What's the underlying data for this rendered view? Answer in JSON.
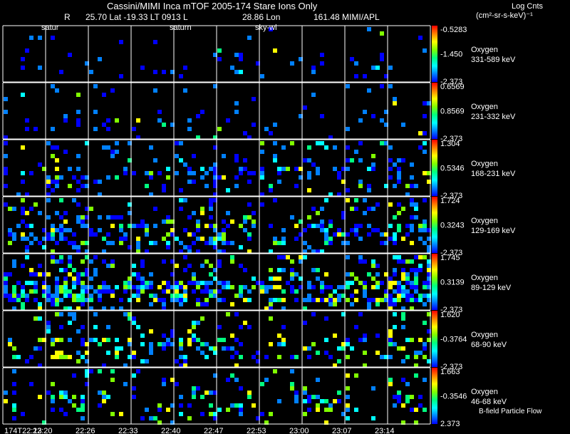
{
  "header": {
    "title": "Cassini/MIMI Inca mTOF  2005-174   Stare    Ions Only",
    "r_label": "R",
    "position_info": "25.70 Lat -19.33 LT 0913 L",
    "lon_value": "28.86 Lon",
    "lon_extra": "161.48  MIMI/APL",
    "units_title": "Log Cnts",
    "units_sub": "(cm²-sr-s-keV)⁻¹",
    "bfield_legend": "B-field Particle Flow"
  },
  "column_tags": [
    {
      "col": 1,
      "text": "satur"
    },
    {
      "col": 4,
      "text": "saturn"
    },
    {
      "col": 6,
      "text": "sky-wl"
    }
  ],
  "time_labels": [
    "174T22:13",
    "22:20",
    "22:26",
    "22:33",
    "22:40",
    "22:47",
    "22:53",
    "23:00",
    "23:07",
    "23:14"
  ],
  "colors": {
    "colorbar": [
      "#0000ff",
      "#0080ff",
      "#00ffff",
      "#00ff80",
      "#80ff00",
      "#ffff00",
      "#ff8000",
      "#ff0000"
    ],
    "grid": "#ffffff",
    "background": "#000000"
  },
  "chart_data": {
    "type": "heatmap",
    "columns": 10,
    "panels": [
      {
        "species": "Oxygen",
        "energy": "331-589 keV",
        "cbar_max": "-0.5283",
        "cbar_mid": "-1.450",
        "cbar_min": "-2.373",
        "density": 0.025,
        "hot": 0.1
      },
      {
        "species": "Oxygen",
        "energy": "231-332 keV",
        "cbar_max": "0.6569",
        "cbar_mid": "0.8569",
        "cbar_min": "-2.373",
        "density": 0.04,
        "hot": 0.15
      },
      {
        "species": "Oxygen",
        "energy": "168-231 keV",
        "cbar_max": "1.304",
        "cbar_mid": "0.5346",
        "cbar_min": "-2.373",
        "density": 0.08,
        "hot": 0.25
      },
      {
        "species": "Oxygen",
        "energy": "129-169 keV",
        "cbar_max": "1.724",
        "cbar_mid": "0.3243",
        "cbar_min": "-2.373",
        "density": 0.12,
        "hot": 0.3
      },
      {
        "species": "Oxygen",
        "energy": "89-129 keV",
        "cbar_max": "1.745",
        "cbar_mid": "0.3139",
        "cbar_min": "-2.373",
        "density": 0.2,
        "hot": 0.4
      },
      {
        "species": "Oxygen",
        "energy": "68-90 keV",
        "cbar_max": "1.620",
        "cbar_mid": "-0.3764",
        "cbar_min": "-2.373",
        "density": 0.1,
        "hot": 0.5
      },
      {
        "species": "Oxygen",
        "energy": "46-68 keV",
        "cbar_max": "1.663",
        "cbar_mid": "-0.3546",
        "cbar_min": "2.373",
        "density": 0.07,
        "hot": 0.55
      }
    ]
  }
}
